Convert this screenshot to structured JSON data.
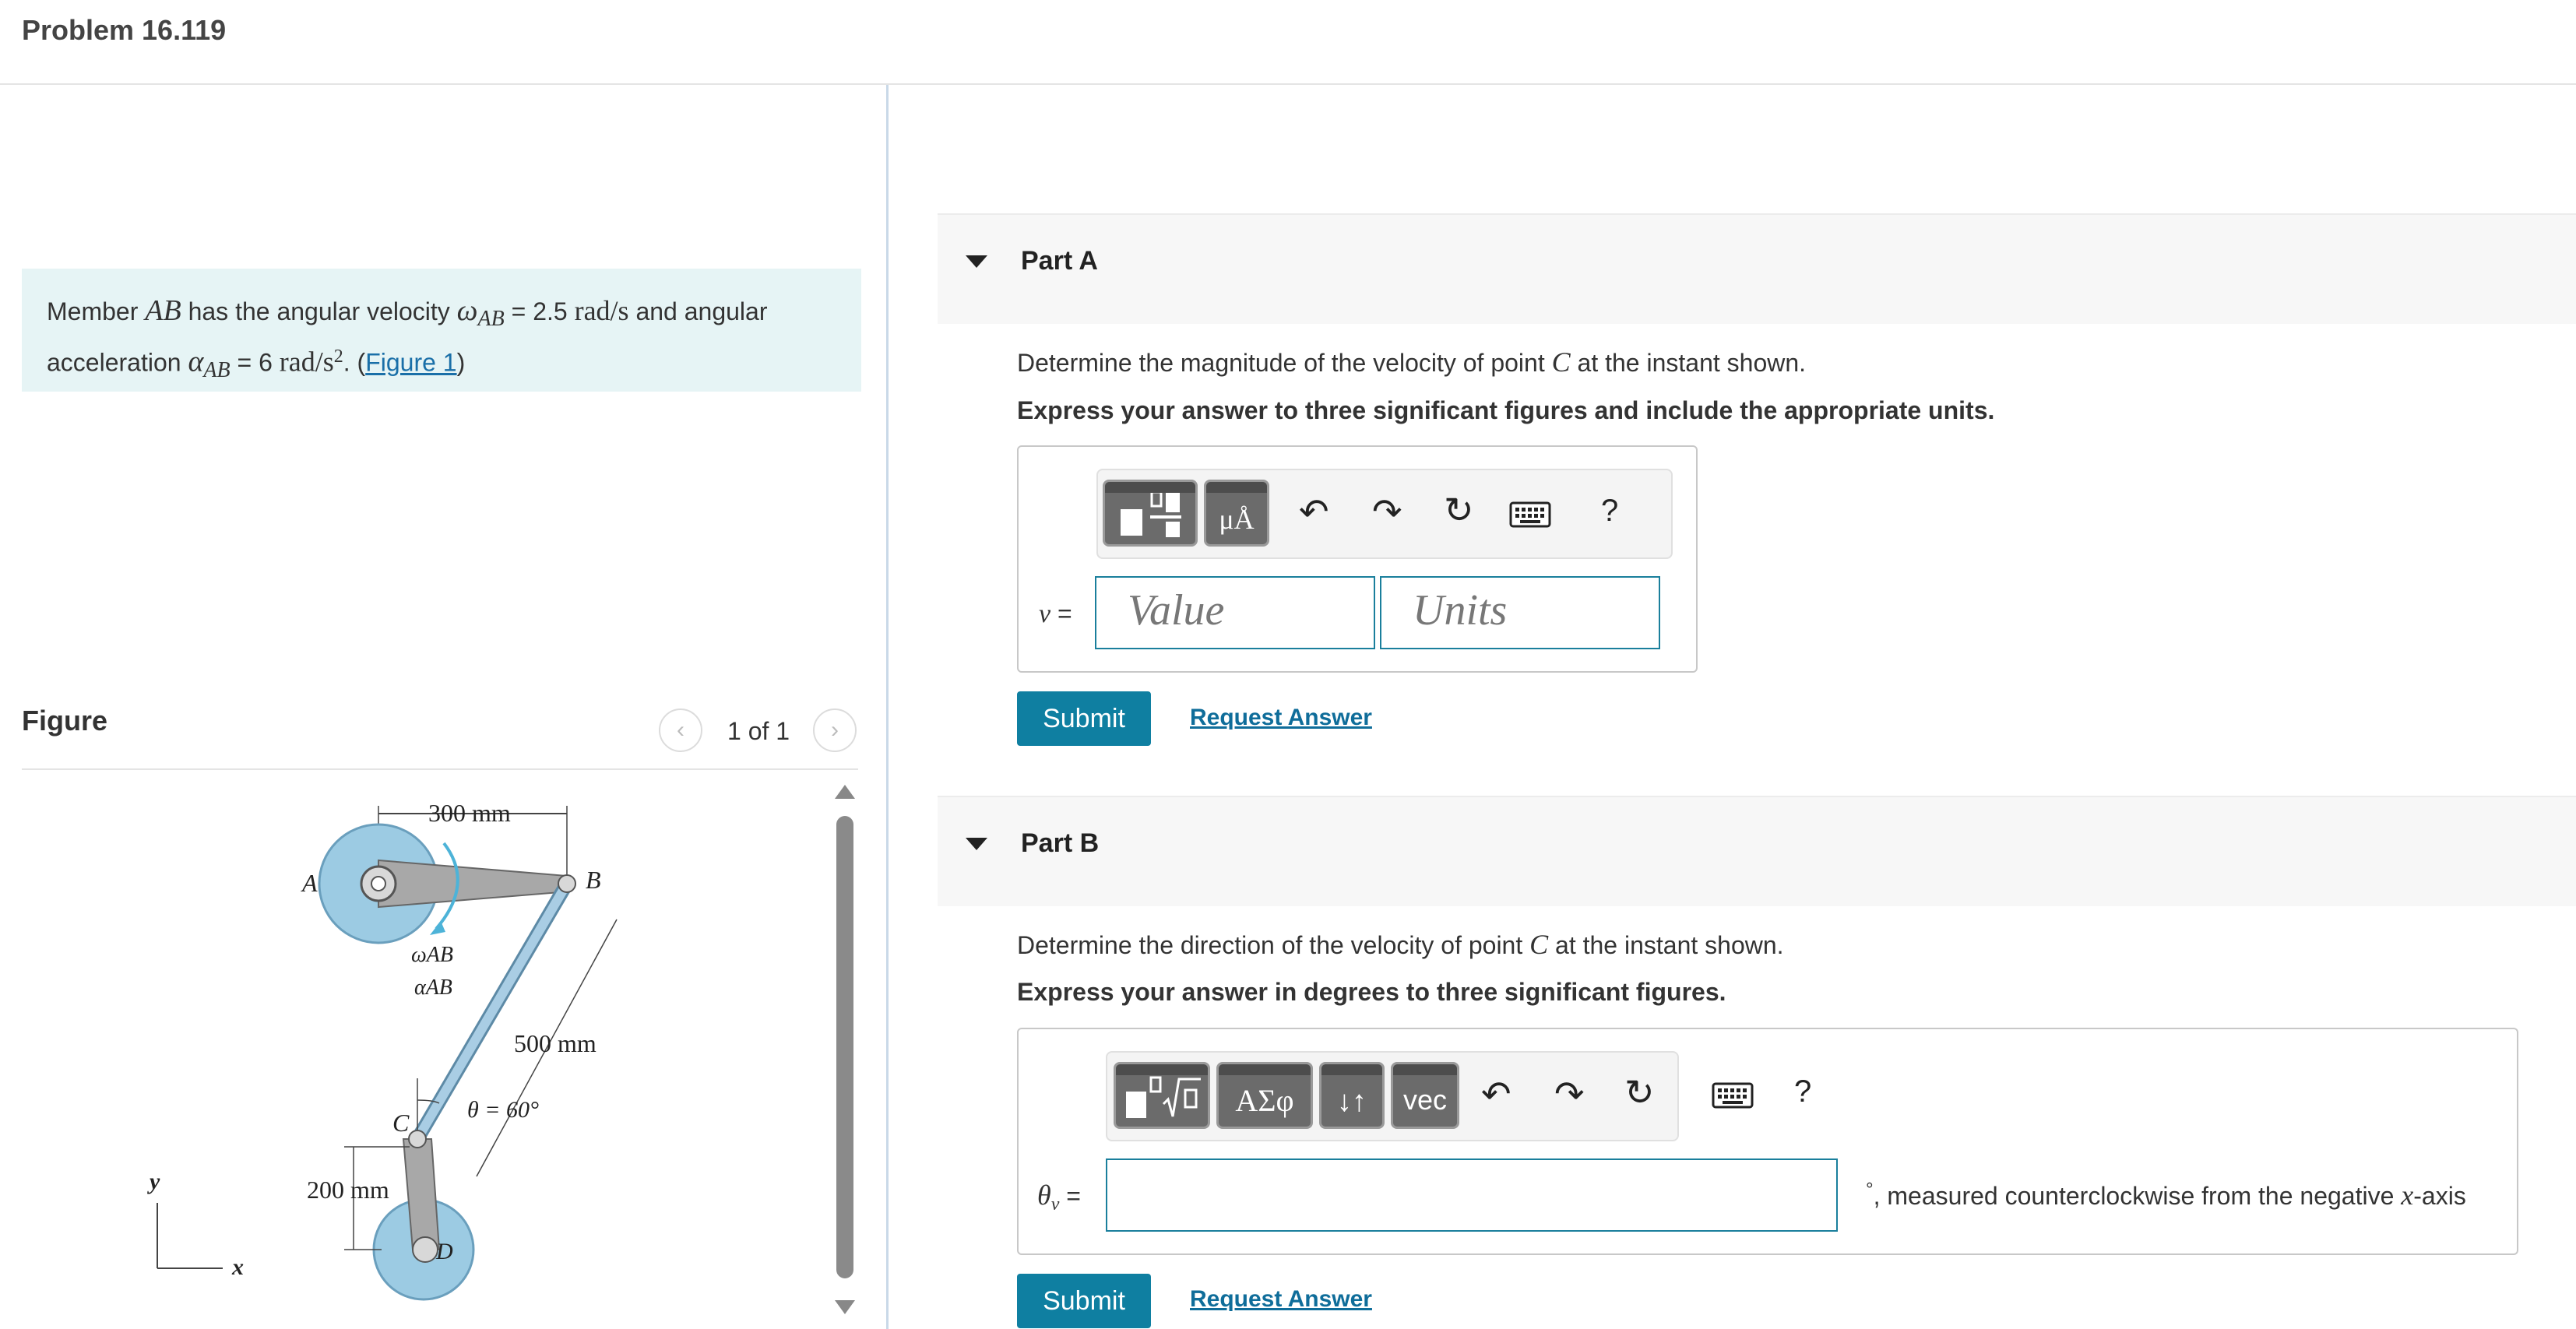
{
  "header": {
    "title": "Problem 16.119"
  },
  "problem": {
    "t1": "Member ",
    "ab": "AB",
    "t2": " has the angular velocity ",
    "omega": "ω",
    "sub_ab": "AB",
    "t3": " = 2.5 ",
    "unit1": "rad/s",
    "t4": " and angular",
    "t5": "acceleration ",
    "alpha": "α",
    "sub_ab2": "AB",
    "t6": " = 6 ",
    "unit2": "rad/s",
    "sup2": "2",
    "t7": ". (",
    "figure_link": "Figure 1",
    "t8": ")"
  },
  "figure": {
    "label": "Figure",
    "counter": "1 of 1",
    "prev_icon": "chevron-left-icon",
    "next_icon": "chevron-right-icon",
    "labels": {
      "dim_300": "300 mm",
      "pt_A": "A",
      "pt_B": "B",
      "pt_C": "C",
      "pt_D": "D",
      "omega_ab": "ωAB",
      "alpha_ab": "αAB",
      "dim_500": "500 mm",
      "theta": "θ = 60°",
      "dim_200": "200 mm",
      "axis_y": "y",
      "axis_x": "x"
    },
    "colors": {
      "disc": "#9ccbe3",
      "link": "#a8a8a8",
      "bar": "#a9cde4"
    }
  },
  "partA": {
    "title": "Part A",
    "question_pre": "Determine the magnitude of the velocity of point ",
    "question_var": "C",
    "question_post": " at the instant shown.",
    "instruction": "Express your answer to three significant figures and include the appropriate units.",
    "var_label": "v",
    "eq": " =",
    "value_placeholder": "Value",
    "units_placeholder": "Units",
    "toolbar": {
      "units_btn": "μÅ",
      "help": "?"
    },
    "submit": "Submit",
    "request": "Request Answer"
  },
  "partB": {
    "title": "Part B",
    "question_pre": "Determine the direction of the velocity of point ",
    "question_var": "C",
    "question_post": " at the instant shown.",
    "instruction": "Express your answer in degrees to three significant figures.",
    "var_label": "θ",
    "var_sub": "v",
    "eq": " =",
    "suffix_deg": "°",
    "suffix_text": ", measured counterclockwise from the negative ",
    "suffix_var": "x",
    "suffix_end": "-axis",
    "toolbar": {
      "greek_btn": "ΑΣφ",
      "arrows_btn": "↓↑",
      "vec_btn": "vec",
      "help": "?"
    },
    "submit": "Submit",
    "request": "Request Answer"
  },
  "colors": {
    "accent": "#0f7fa1",
    "problem_bg": "#e6f4f5",
    "link": "#1a6fa8"
  }
}
